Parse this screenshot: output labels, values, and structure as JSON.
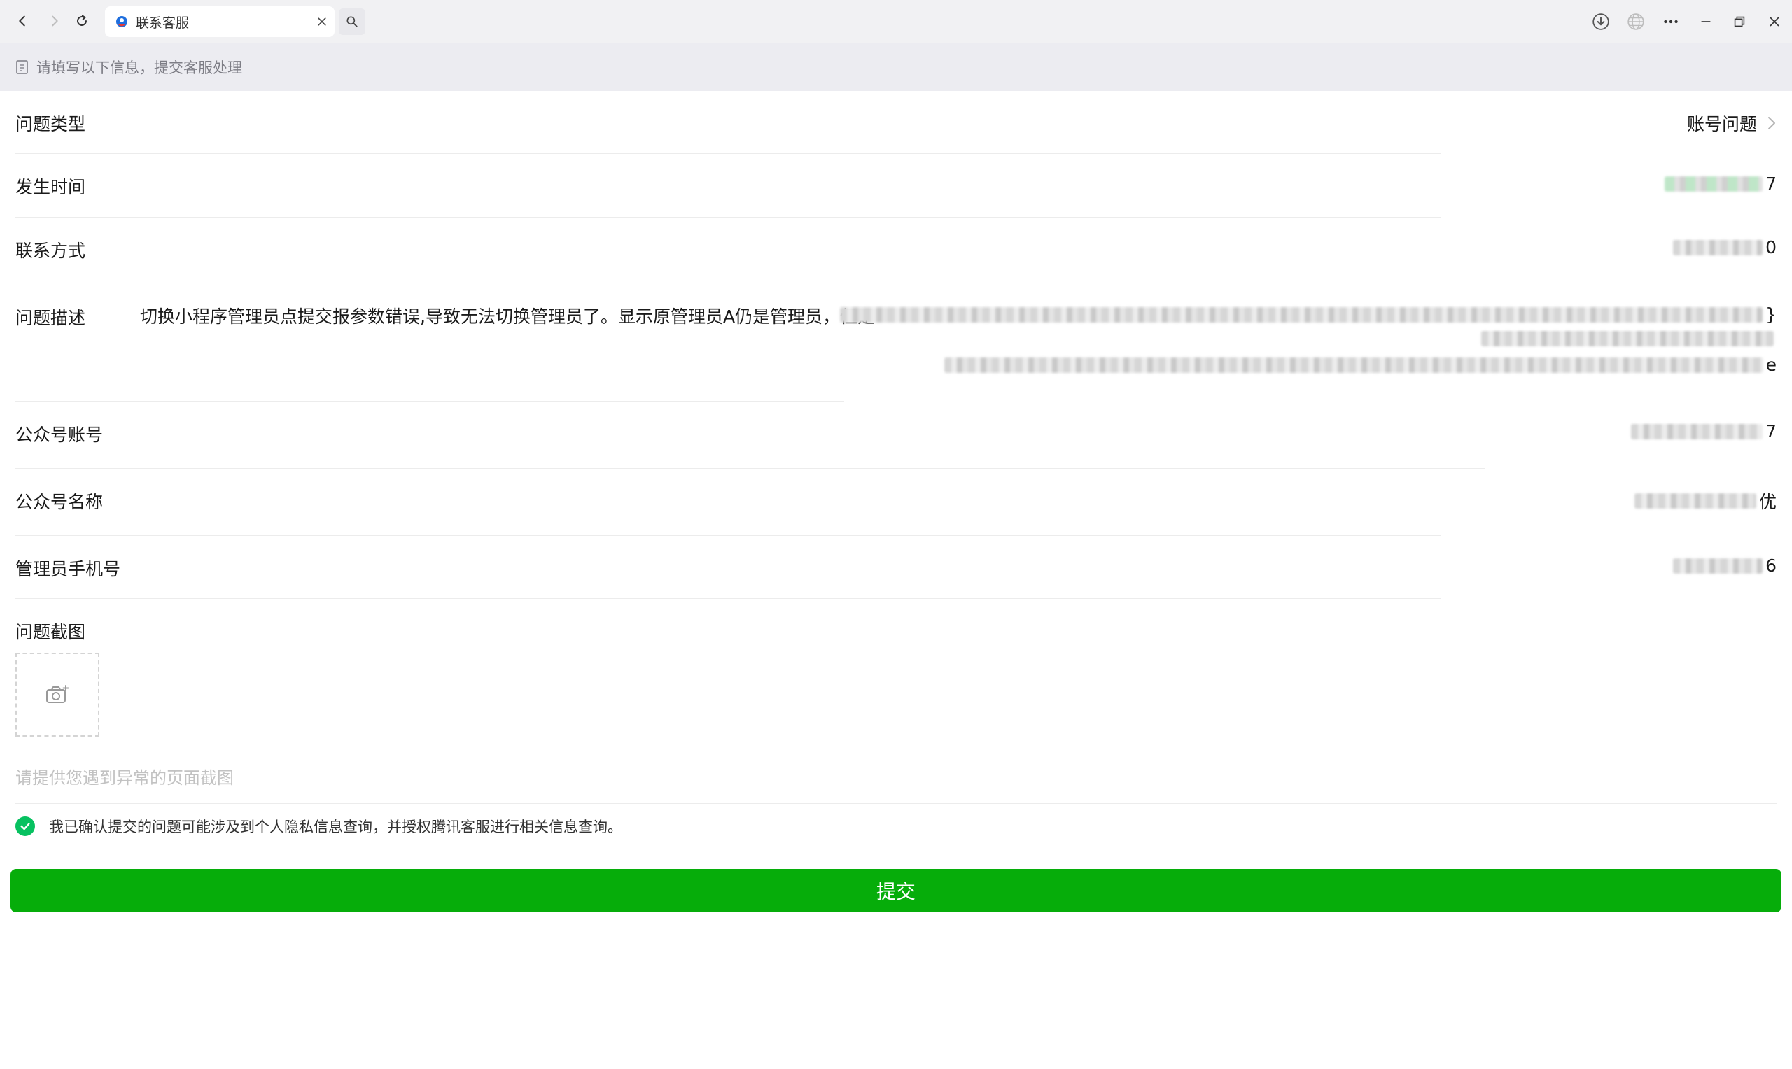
{
  "browser": {
    "tab_title": "联系客服",
    "icons": [
      "back-icon",
      "forward-icon",
      "reload-icon",
      "close-icon",
      "search-icon",
      "download-icon",
      "globe-icon",
      "more-icon",
      "minimize-icon",
      "restore-icon",
      "window-close-icon"
    ]
  },
  "notice": {
    "text": "请填写以下信息，提交客服处理"
  },
  "form": {
    "issue_type": {
      "label": "问题类型",
      "value": "账号问题"
    },
    "time": {
      "label": "发生时间",
      "value_tail": "7"
    },
    "contact": {
      "label": "联系方式",
      "value_tail": "0"
    },
    "description": {
      "label": "问题描述",
      "text": "切换小程序管理员点提交报参数错误,导致无法切换管理员了。显示原管理员A仍是管理员，但是",
      "line1_tail": "}",
      "line3_tail": "e"
    },
    "account": {
      "label": "公众号账号",
      "value_tail": "7"
    },
    "account_name": {
      "label": "公众号名称",
      "value_tail": "优"
    },
    "admin_phone": {
      "label": "管理员手机号",
      "value_tail": "6"
    },
    "screenshot": {
      "label": "问题截图",
      "hint": "请提供您遇到异常的页面截图"
    }
  },
  "consent": {
    "checked": true,
    "text": "我已确认提交的问题可能涉及到个人隐私信息查询，并授权腾讯客服进行相关信息查询。"
  },
  "submit": {
    "label": "提交"
  },
  "colors": {
    "accent": "#06ad0a",
    "check": "#07c160"
  }
}
